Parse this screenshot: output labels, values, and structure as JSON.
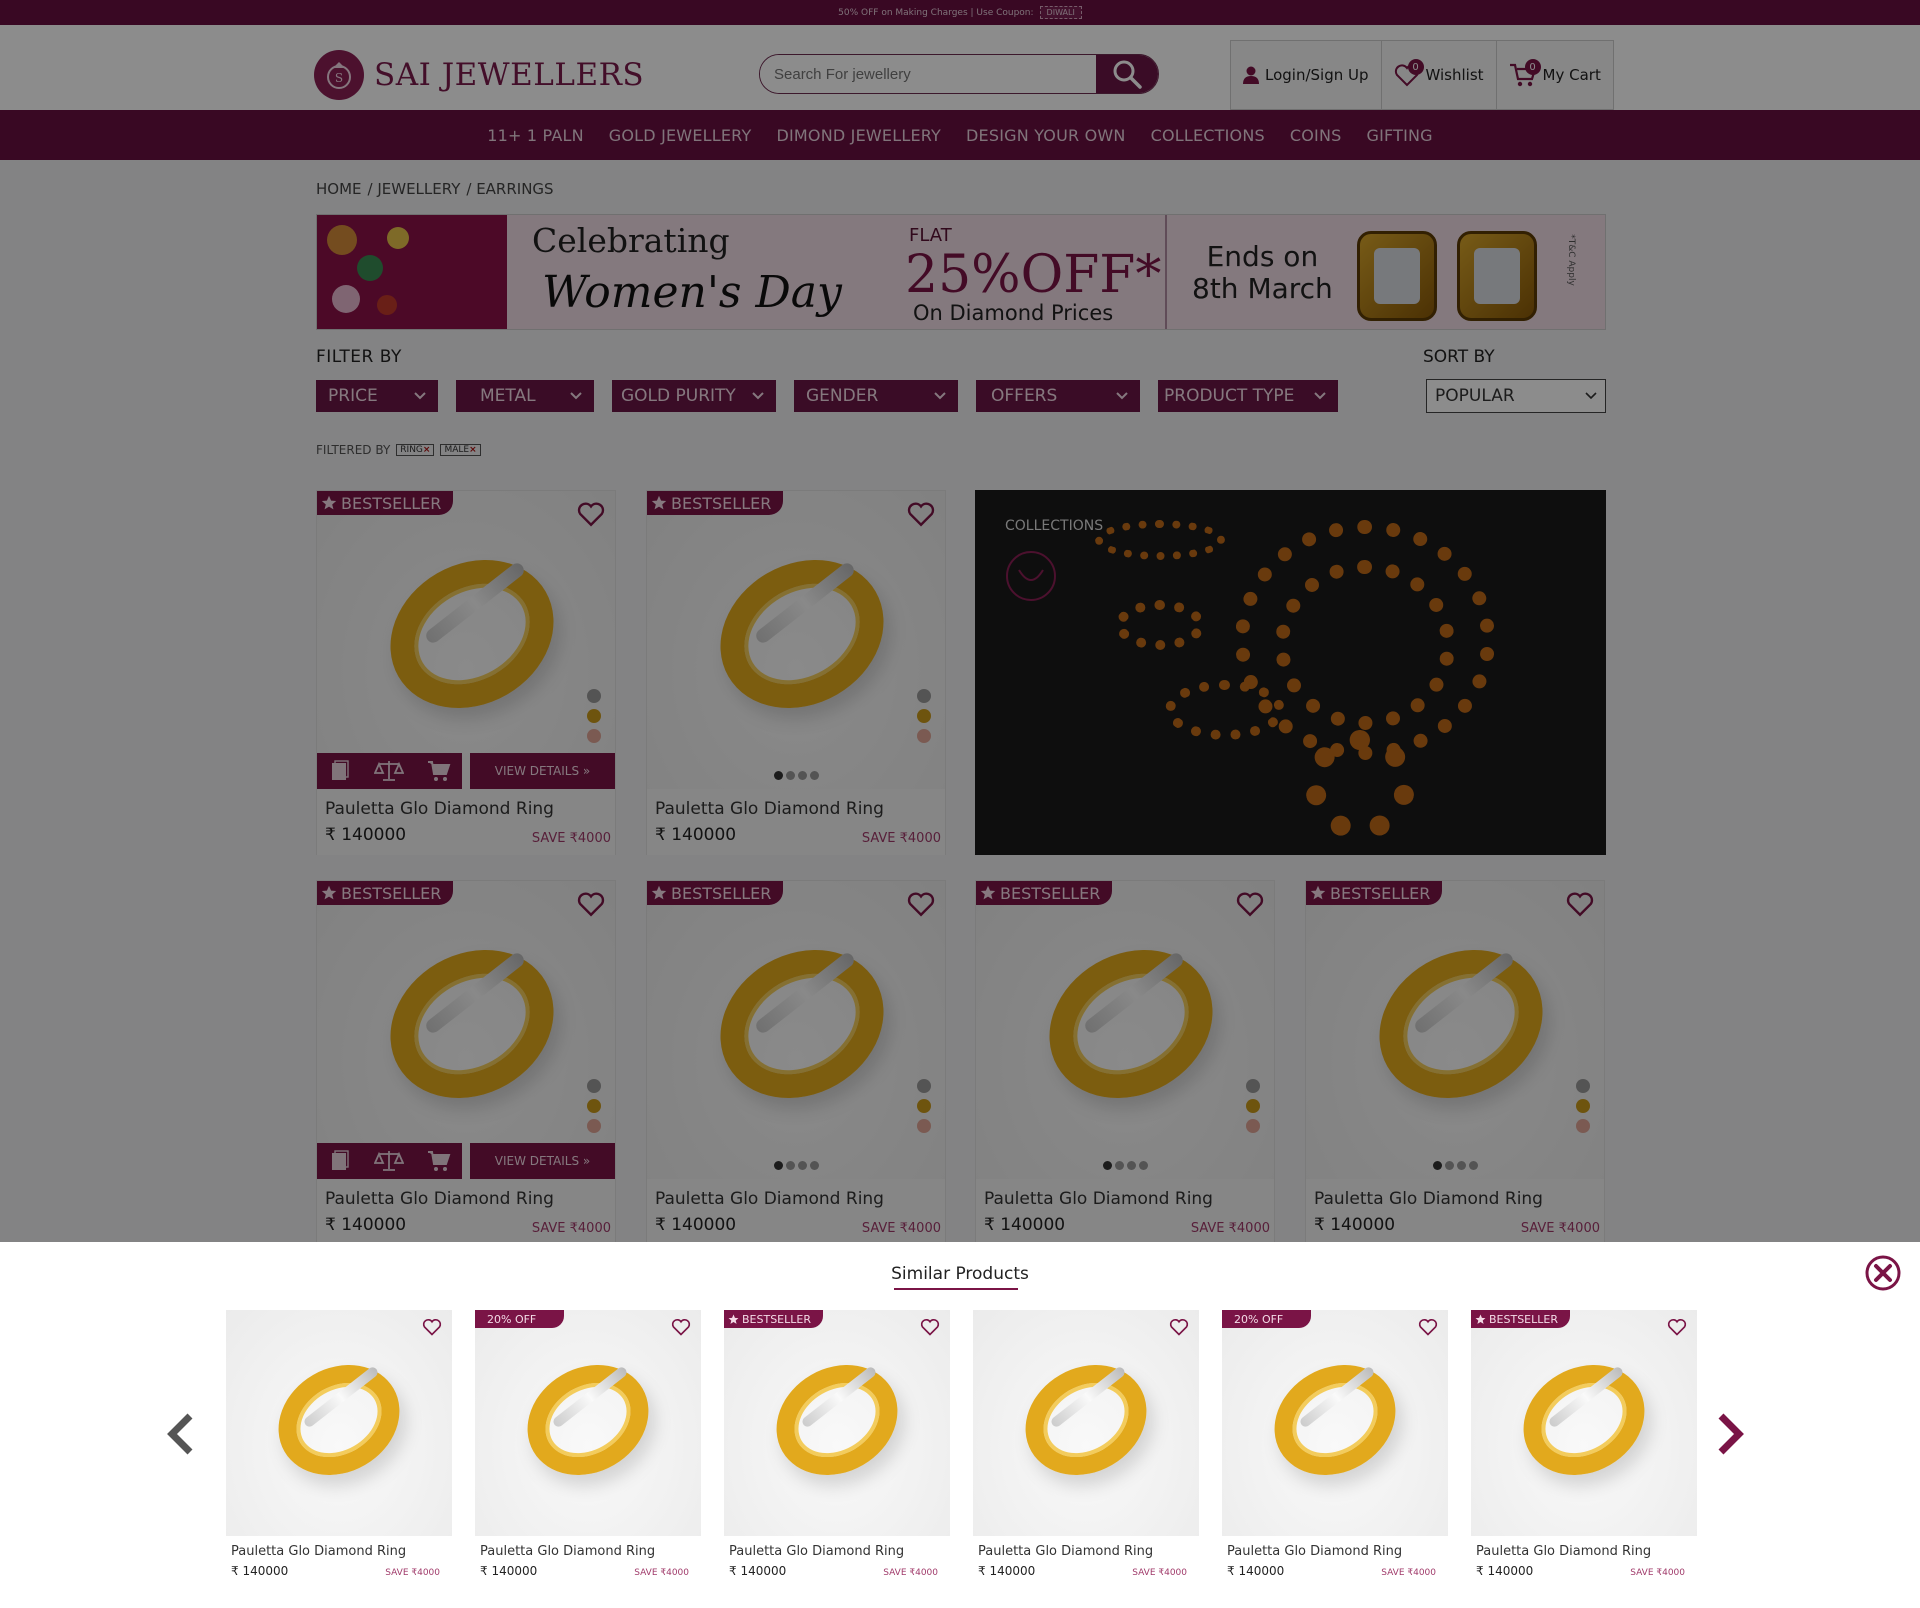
{
  "topbar": {
    "text": "50% OFF on Making Charges | Use Coupon:",
    "coupon": "DIWALI"
  },
  "header": {
    "brand": "SAI JEWELLERS",
    "search_placeholder": "Search For jewellery",
    "login": "Login/Sign Up",
    "wishlist": "Wishlist",
    "wishlist_count": "0",
    "cart": "My Cart",
    "cart_count": "0"
  },
  "nav": [
    "11+ 1 PALN",
    "GOLD JEWELLERY",
    "DIMOND JEWELLERY",
    "DESIGN YOUR OWN",
    "COLLECTIONS",
    "COINS",
    "GIFTING"
  ],
  "breadcrumb": [
    "HOME",
    "/ JEWELLERY",
    "/ EARRINGS"
  ],
  "banner": {
    "celebrating": "Celebrating",
    "womens_day": "Women's Day",
    "flat": "FLAT",
    "discount": "25%OFF*",
    "on": "On Diamond Prices",
    "ends_1": "Ends on",
    "ends_2": "8th March",
    "tc": "*T&C Apply"
  },
  "filters": {
    "label": "FILTER BY",
    "items": [
      "PRICE",
      "METAL",
      "GOLD PURITY",
      "GENDER",
      "OFFERS",
      "PRODUCT TYPE"
    ],
    "sort_label": "SORT BY",
    "sort_value": "POPULAR",
    "filtered_label": "FILTERED BY",
    "chips": [
      "RING",
      "MALE"
    ]
  },
  "product": {
    "badge": "BESTSELLER",
    "name": "Pauletta Glo Diamond Ring",
    "price": "₹ 140000",
    "save": "SAVE ₹4000",
    "view_details": "VIEW DETAILS »"
  },
  "collection_label": "COLLECTIONS",
  "similar": {
    "title": "Similar Products",
    "items": [
      {
        "tag": "",
        "name": "Pauletta Glo Diamond Ring",
        "price": "₹ 140000",
        "save": "SAVE ₹4000"
      },
      {
        "tag": "20% OFF",
        "name": "Pauletta Glo Diamond Ring",
        "price": "₹ 140000",
        "save": "SAVE ₹4000"
      },
      {
        "tag": "BESTSELLER",
        "name": "Pauletta Glo Diamond Ring",
        "price": "₹ 140000",
        "save": "SAVE ₹4000"
      },
      {
        "tag": "",
        "name": "Pauletta Glo Diamond Ring",
        "price": "₹ 140000",
        "save": "SAVE ₹4000"
      },
      {
        "tag": "20% OFF",
        "name": "Pauletta Glo Diamond Ring",
        "price": "₹ 140000",
        "save": "SAVE ₹4000"
      },
      {
        "tag": "BESTSELLER",
        "name": "Pauletta Glo Diamond Ring",
        "price": "₹ 140000",
        "save": "SAVE ₹4000"
      }
    ]
  },
  "colors": {
    "brand": "#680f41",
    "accent": "#7a1446",
    "metal_silver": "#9a9a9a",
    "metal_gold": "#c99a1a",
    "metal_rose": "#e0a496"
  }
}
